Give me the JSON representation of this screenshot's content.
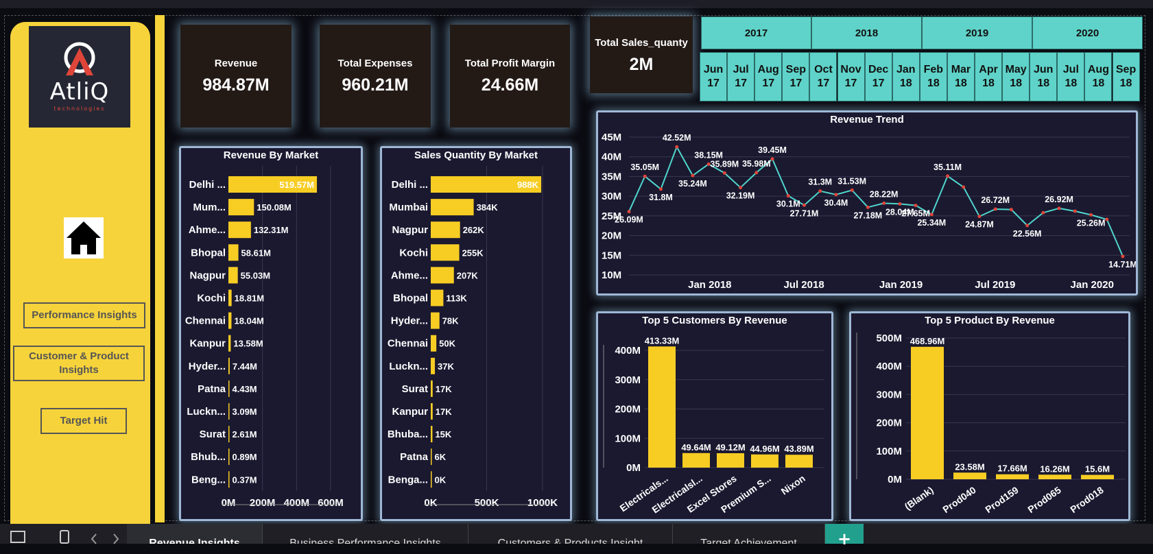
{
  "sidebar": {
    "logo_text": "AtliQ",
    "logo_sub": "technologies",
    "nav": [
      "Performance Insights",
      "Customer & Product Insights",
      "Target Hit"
    ]
  },
  "kpis": {
    "revenue": {
      "label": "Revenue",
      "value": "984.87M"
    },
    "expenses": {
      "label": "Total Expenses",
      "value": "960.21M"
    },
    "profit": {
      "label": "Total Profit Margin",
      "value": "24.66M"
    },
    "qty": {
      "label": "Total Sales_quanty",
      "value": "2M"
    }
  },
  "slicer": {
    "years": [
      "2017",
      "2018",
      "2019",
      "2020"
    ],
    "months": [
      [
        "Jun",
        "17"
      ],
      [
        "Jul",
        "17"
      ],
      [
        "Aug",
        "17"
      ],
      [
        "Sep",
        "17"
      ],
      [
        "Oct",
        "17"
      ],
      [
        "Nov",
        "17"
      ],
      [
        "Dec",
        "17"
      ],
      [
        "Jan",
        "18"
      ],
      [
        "Feb",
        "18"
      ],
      [
        "Mar",
        "18"
      ],
      [
        "Apr",
        "18"
      ],
      [
        "May",
        "18"
      ],
      [
        "Jun",
        "18"
      ],
      [
        "Jul",
        "18"
      ],
      [
        "Aug",
        "18"
      ],
      [
        "Sep",
        "18"
      ]
    ]
  },
  "colors": {
    "bar": "#f7cd24",
    "line": "#4fd6cc",
    "marker": "#e0453a",
    "panel": "#1b1930"
  },
  "chart_data": [
    {
      "type": "line",
      "title": "Revenue Trend",
      "x_labels": [
        "Jan 2018",
        "Jul 2018",
        "Jan 2019",
        "Jul 2019",
        "Jan 2020"
      ],
      "y_ticks": [
        "45M",
        "40M",
        "35M",
        "30M",
        "25M",
        "20M",
        "15M",
        "10M"
      ],
      "ylim": [
        10,
        45
      ],
      "values": [
        26.09,
        35.05,
        31.8,
        42.52,
        35.24,
        38.15,
        35.89,
        32.19,
        35.98,
        39.45,
        30.1,
        27.71,
        31.3,
        30.4,
        31.53,
        27.18,
        28.22,
        28.04,
        27.65,
        25.34,
        35.11,
        32.3,
        24.87,
        26.72,
        26.6,
        22.56,
        25.8,
        26.92,
        26.2,
        25.26,
        24.1,
        14.71
      ],
      "labels": [
        "26.09M",
        "35.05M",
        "31.8M",
        "42.52M",
        "35.24M",
        "38.15M",
        "35.89M",
        "32.19M",
        "35.98M",
        "39.45M",
        "30.1M",
        "27.71M",
        "31.3M",
        "30.4M",
        "31.53M",
        "27.18M",
        "28.22M",
        "28.04M",
        "27.65M",
        "25.34M",
        "35.11M",
        "",
        "24.87M",
        "26.72M",
        "",
        "22.56M",
        "",
        "26.92M",
        "",
        "25.26M",
        "",
        "14.71M"
      ]
    },
    {
      "type": "bar",
      "title": "Revenue By Market",
      "categories": [
        "Delhi ...",
        "Mum...",
        "Ahme...",
        "Bhopal",
        "Nagpur",
        "Kochi",
        "Chennai",
        "Kanpur",
        "Hyder...",
        "Patna",
        "Luckn...",
        "Surat",
        "Bhub...",
        "Beng..."
      ],
      "values": [
        519.57,
        150.08,
        132.31,
        58.61,
        55.03,
        18.81,
        18.04,
        13.58,
        7.44,
        4.43,
        3.09,
        2.61,
        0.89,
        0.37
      ],
      "labels": [
        "519.57M",
        "150.08M",
        "132.31M",
        "58.61M",
        "55.03M",
        "18.81M",
        "18.04M",
        "13.58M",
        "7.44M",
        "4.43M",
        "3.09M",
        "2.61M",
        "0.89M",
        "0.37M"
      ],
      "x_ticks": [
        "0M",
        "200M",
        "400M",
        "600M"
      ],
      "xlim": [
        0,
        600
      ]
    },
    {
      "type": "bar",
      "title": "Sales Quantity By Market",
      "categories": [
        "Delhi ...",
        "Mumbai",
        "Nagpur",
        "Kochi",
        "Ahme...",
        "Bhopal",
        "Hyder...",
        "Chennai",
        "Luckn...",
        "Surat",
        "Kanpur",
        "Bhuba...",
        "Patna",
        "Benga..."
      ],
      "values": [
        988,
        384,
        262,
        255,
        207,
        113,
        78,
        50,
        37,
        17,
        17,
        15,
        6,
        0
      ],
      "labels": [
        "988K",
        "384K",
        "262K",
        "255K",
        "207K",
        "113K",
        "78K",
        "50K",
        "37K",
        "17K",
        "17K",
        "15K",
        "6K",
        "0K"
      ],
      "x_ticks": [
        "0K",
        "500K",
        "1000K"
      ],
      "xlim": [
        0,
        1000
      ]
    },
    {
      "type": "bar",
      "title": "Top 5 Customers By Revenue",
      "categories": [
        "Electricals...",
        "Electricalsl...",
        "Excel Stores",
        "Premium S...",
        "Nixon"
      ],
      "values": [
        413.33,
        49.64,
        49.12,
        44.96,
        43.89
      ],
      "labels": [
        "413.33M",
        "49.64M",
        "49.12M",
        "44.96M",
        "43.89M"
      ],
      "y_ticks": [
        "400M",
        "300M",
        "200M",
        "100M",
        "0M"
      ],
      "ylim": [
        0,
        400
      ]
    },
    {
      "type": "bar",
      "title": "Top 5 Product By Revenue",
      "categories": [
        "(Blank)",
        "Prod040",
        "Prod159",
        "Prod065",
        "Prod018"
      ],
      "values": [
        468.96,
        23.58,
        17.66,
        16.26,
        15.6
      ],
      "labels": [
        "468.96M",
        "23.58M",
        "17.66M",
        "16.26M",
        "15.6M"
      ],
      "y_ticks": [
        "500M",
        "400M",
        "300M",
        "200M",
        "100M",
        "0M"
      ],
      "ylim": [
        0,
        500
      ]
    }
  ],
  "tabs": [
    "Revenue Insights",
    "Business Performance Insights",
    "Customers & Products Insight",
    "Target Achievement"
  ],
  "add_tab": "+"
}
